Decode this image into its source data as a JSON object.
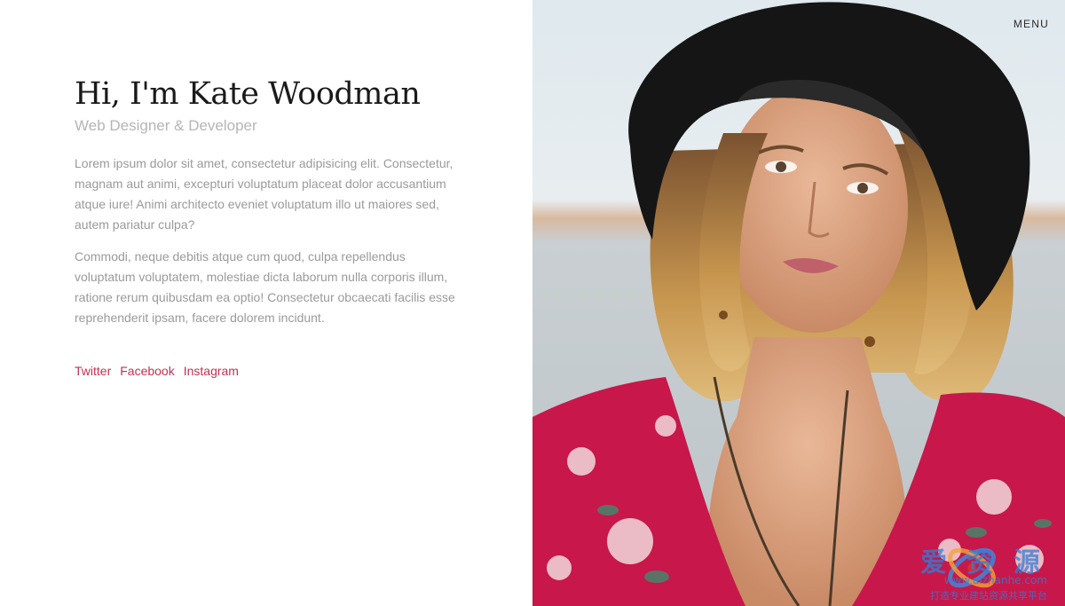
{
  "header": {
    "menu_label": "MENU"
  },
  "profile": {
    "name": "Hi, I'm Kate Woodman",
    "role": "Web Designer & Developer",
    "bio": [
      "Lorem ipsum dolor sit amet, consectetur adipisicing elit. Consectetur, magnam aut animi, excepturi voluptatum placeat dolor accusantium atque iure! Animi architecto eveniet voluptatum illo ut maiores sed, autem pariatur culpa?",
      "Commodi, neque debitis atque cum quod, culpa repellendus voluptatum voluptatem, molestiae dicta laborum nulla corporis illum, ratione rerum quibusdam ea optio! Consectetur obcaecati facilis esse reprehenderit ipsam, facere dolorem incidunt."
    ]
  },
  "social": [
    "Twitter",
    "Facebook",
    "Instagram"
  ],
  "watermark": {
    "title": "爱 资 源",
    "url": "www.aizhanhe.com",
    "tagline": "打造专业建站资源共享平台"
  },
  "colors": {
    "accent": "#c0334f",
    "heading": "#1a1a1a",
    "subtitle": "#b5b5b5",
    "body_text": "#9a9a9a",
    "background": "#ffffff"
  },
  "icons": {
    "menu": "menu-text",
    "photo": "portrait-photo",
    "watermark": "watermark-logo"
  }
}
